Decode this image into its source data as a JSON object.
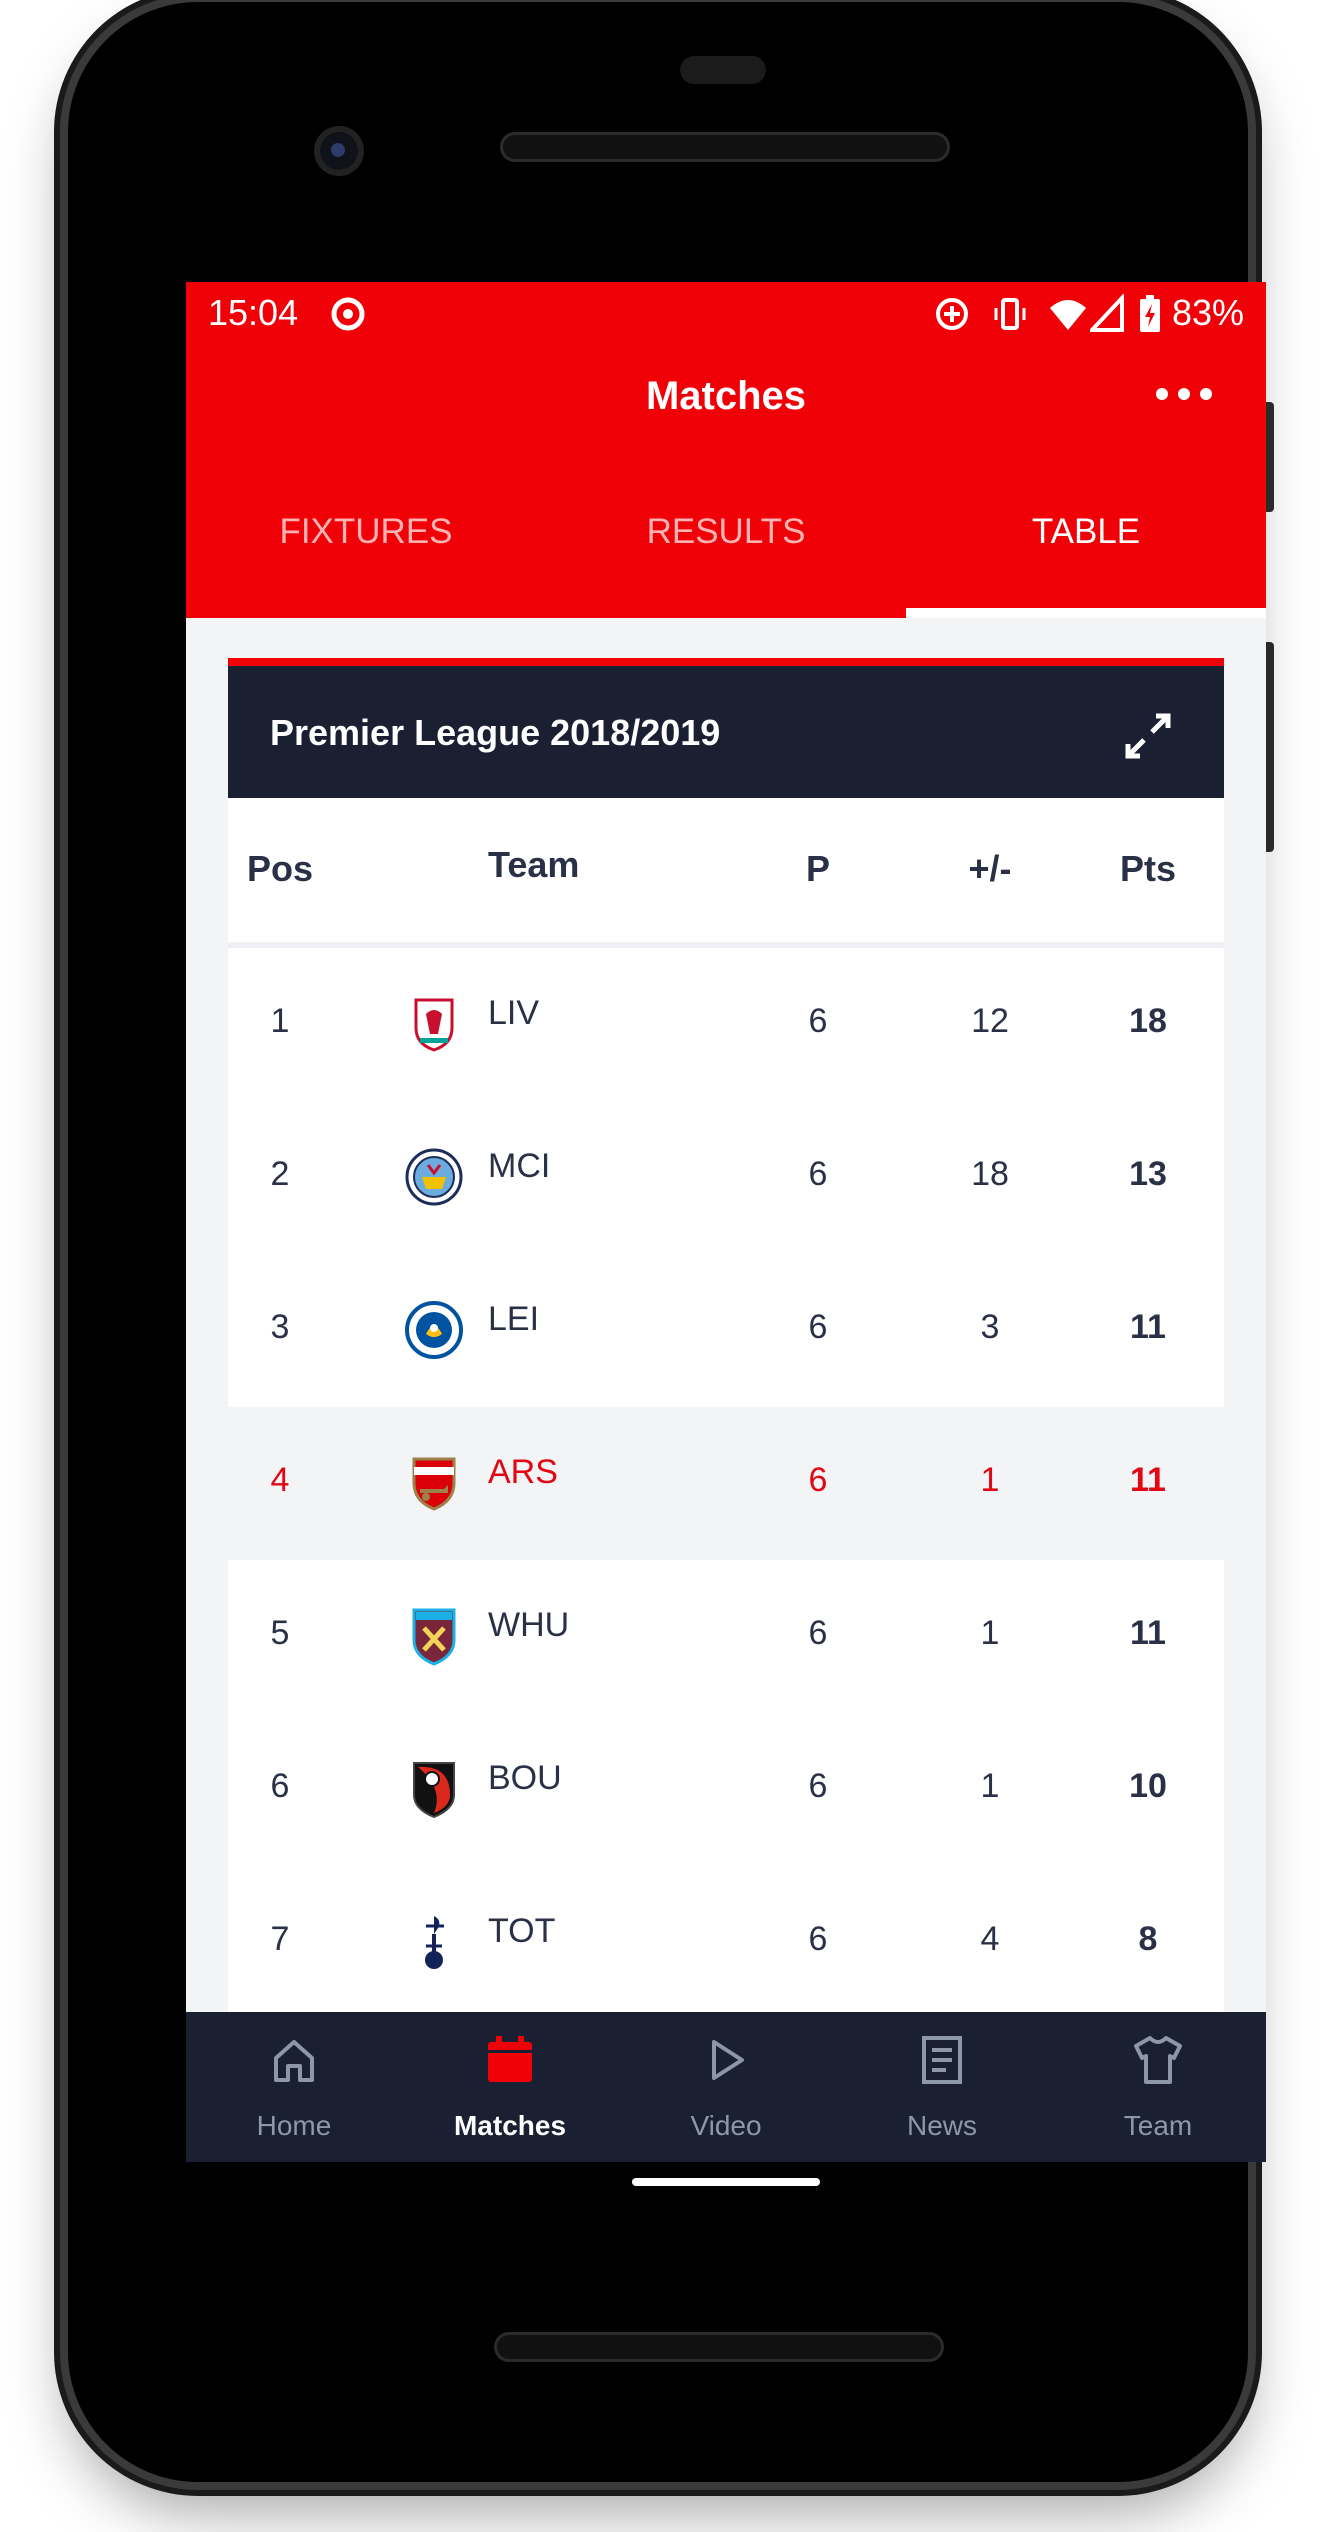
{
  "status_bar": {
    "time": "15:04",
    "battery_percent": "83%",
    "icons": [
      "data-saver-icon",
      "add-circle-icon",
      "vibrate-icon",
      "wifi-icon",
      "signal-icon",
      "battery-charging-icon"
    ]
  },
  "app_bar": {
    "title": "Matches",
    "more_icon": "more-horizontal-icon"
  },
  "tabs": [
    {
      "label": "FIXTURES",
      "active": false
    },
    {
      "label": "RESULTS",
      "active": false
    },
    {
      "label": "TABLE",
      "active": true
    }
  ],
  "league": {
    "name": "Premier League 2018/2019",
    "expand_icon": "expand-icon"
  },
  "table": {
    "headers": {
      "pos": "Pos",
      "team": "Team",
      "p": "P",
      "gd": "+/-",
      "pts": "Pts"
    },
    "rows": [
      {
        "pos": "1",
        "team": "LIV",
        "p": "6",
        "gd": "12",
        "pts": "18",
        "highlight": false
      },
      {
        "pos": "2",
        "team": "MCI",
        "p": "6",
        "gd": "18",
        "pts": "13",
        "highlight": false
      },
      {
        "pos": "3",
        "team": "LEI",
        "p": "6",
        "gd": "3",
        "pts": "11",
        "highlight": false
      },
      {
        "pos": "4",
        "team": "ARS",
        "p": "6",
        "gd": "1",
        "pts": "11",
        "highlight": true
      },
      {
        "pos": "5",
        "team": "WHU",
        "p": "6",
        "gd": "1",
        "pts": "11",
        "highlight": false
      },
      {
        "pos": "6",
        "team": "BOU",
        "p": "6",
        "gd": "1",
        "pts": "10",
        "highlight": false
      },
      {
        "pos": "7",
        "team": "TOT",
        "p": "6",
        "gd": "4",
        "pts": "8",
        "highlight": false
      }
    ]
  },
  "bottom_nav": [
    {
      "label": "Home",
      "icon": "home-icon",
      "active": false
    },
    {
      "label": "Matches",
      "icon": "calendar-icon",
      "active": true
    },
    {
      "label": "Video",
      "icon": "play-icon",
      "active": false
    },
    {
      "label": "News",
      "icon": "news-icon",
      "active": false
    },
    {
      "label": "Team",
      "icon": "shirt-icon",
      "active": false
    }
  ],
  "colors": {
    "brand_red": "#ef0107",
    "navy": "#1a2031",
    "highlight_text": "#e30613"
  }
}
